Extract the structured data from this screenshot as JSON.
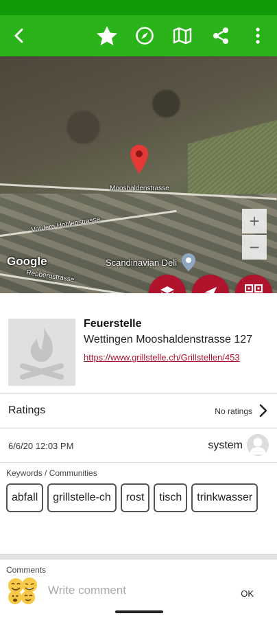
{
  "colors": {
    "status_bar": "#119b09",
    "app_bar": "#2bb31a",
    "accent": "#b0142d",
    "link": "#b0142d"
  },
  "toolbar": {
    "icons": [
      "back-arrow-icon",
      "star-icon",
      "compass-icon",
      "map-icon",
      "share-icon",
      "more-vert-icon"
    ]
  },
  "map": {
    "labels": {
      "street_1": "Mooshaldenstrasse",
      "street_2": "Vordere Hohlenstrasse",
      "street_3": "Rebbergstrasse",
      "place": "Scandinavian Deli",
      "provider": "Google"
    },
    "zoom_in": "+",
    "zoom_out": "−",
    "fabs": [
      "layers-icon",
      "navigation-icon",
      "qr-code-icon"
    ]
  },
  "detail": {
    "type": "Feuerstelle",
    "address": "Wettingen Mooshaldenstrasse 127",
    "link": "https://www.grillstelle.ch/Grillstellen/453"
  },
  "ratings": {
    "label": "Ratings",
    "value": "No ratings"
  },
  "meta": {
    "date": "6/6/20 12:03 PM",
    "user": "system"
  },
  "keywords": {
    "caption": "Keywords / Communities",
    "items": [
      "abfall",
      "grillstelle-ch",
      "rost",
      "tisch",
      "trinkwasser"
    ]
  },
  "comments": {
    "caption": "Comments",
    "placeholder": "Write comment",
    "ok_label": "OK"
  }
}
